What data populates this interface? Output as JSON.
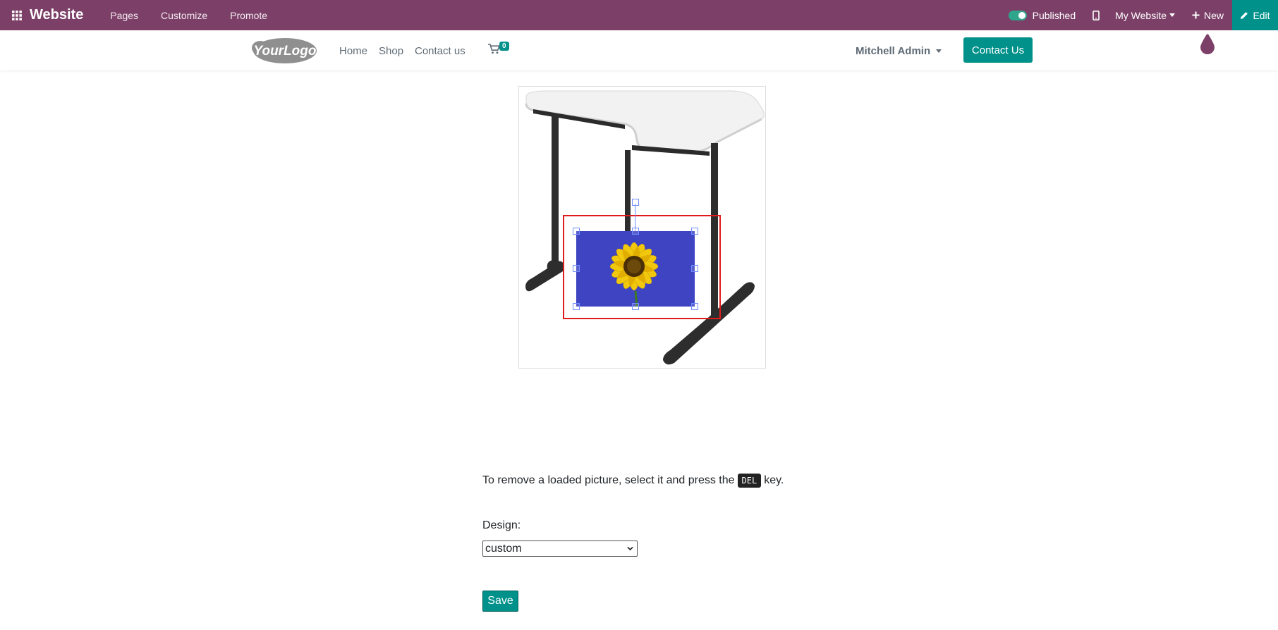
{
  "topbar": {
    "brand": "Website",
    "menu": [
      "Pages",
      "Customize",
      "Promote"
    ],
    "published_label": "Published",
    "my_website_label": "My Website",
    "new_label": "New",
    "edit_label": "Edit",
    "icons": [
      "apps-grid-icon",
      "mobile-preview-icon",
      "plus-icon",
      "pencil-icon"
    ],
    "bar_color": "#7c4068",
    "edit_color": "#00918a"
  },
  "header": {
    "logo_text": "YourLogo",
    "nav": [
      "Home",
      "Shop",
      "Contact us"
    ],
    "cart_count": "0",
    "user_name": "Mitchell Admin",
    "contact_button": "Contact Us",
    "accent_color": "#00918a"
  },
  "editor": {
    "selection_color": "#e01b1b",
    "handle_color": "#6f8dff"
  },
  "form": {
    "help_before": "To remove a loaded picture, select it and press the",
    "help_key": "DEL",
    "help_after": "key.",
    "design_label": "Design:",
    "design_value": "custom",
    "save_label": "Save"
  }
}
